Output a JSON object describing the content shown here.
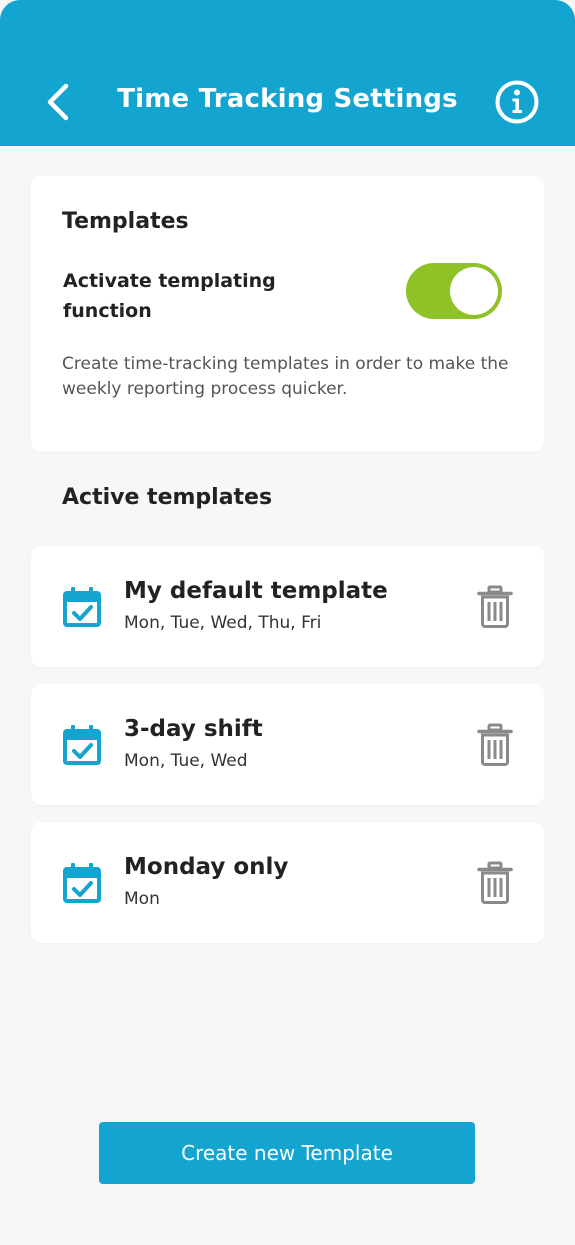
{
  "header": {
    "title": "Time Tracking Settings",
    "back_icon": "chevron-left-icon",
    "info_icon": "info-icon"
  },
  "settings": {
    "title": "Templates",
    "toggle_label": "Activate templating function",
    "toggle_on": true,
    "description": "Create time-tracking templates in order to make the weekly reporting process quicker."
  },
  "active_section": {
    "title": "Active templates"
  },
  "templates": [
    {
      "name": "My default template",
      "days": "Mon, Tue, Wed, Thu, Fri"
    },
    {
      "name": "3-day shift",
      "days": "Mon, Tue, Wed"
    },
    {
      "name": "Monday only",
      "days": "Mon"
    }
  ],
  "create_button": {
    "label": "Create new Template"
  },
  "colors": {
    "primary": "#13a5cf",
    "toggle_on": "#8fc226",
    "trash": "#8a8a8a",
    "background": "#f7f7f7"
  }
}
